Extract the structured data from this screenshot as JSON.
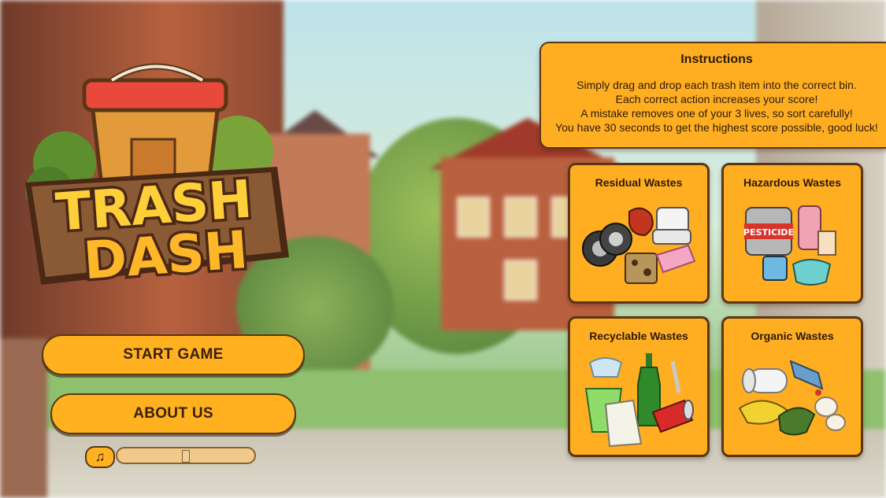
{
  "logo": {
    "line1": "TRASH",
    "line2": "DASH"
  },
  "menu": {
    "start_label": "START GAME",
    "about_label": "ABOUT US"
  },
  "audio": {
    "music_icon": "music-note-icon",
    "volume_glyph": "♫",
    "volume_level": 0.5
  },
  "instructions": {
    "title": "Instructions",
    "lines": [
      "Simply drag and drop each trash item into the correct bin.",
      "Each correct action increases your score!",
      "A mistake removes one of your 3 lives, so sort carefully!",
      "You have 30 seconds to get the highest score possible, good luck!"
    ]
  },
  "bins": [
    {
      "title": "Residual Wastes",
      "icon": "residual-waste-icon"
    },
    {
      "title": "Hazardous Wastes",
      "icon": "hazardous-waste-icon",
      "label": "PESTICIDE"
    },
    {
      "title": "Recyclable Wastes",
      "icon": "recyclable-waste-icon"
    },
    {
      "title": "Organic Wastes",
      "icon": "organic-waste-icon"
    }
  ],
  "colors": {
    "accent": "#ffae22",
    "border": "#5a3616",
    "text": "#2c1a0a"
  }
}
